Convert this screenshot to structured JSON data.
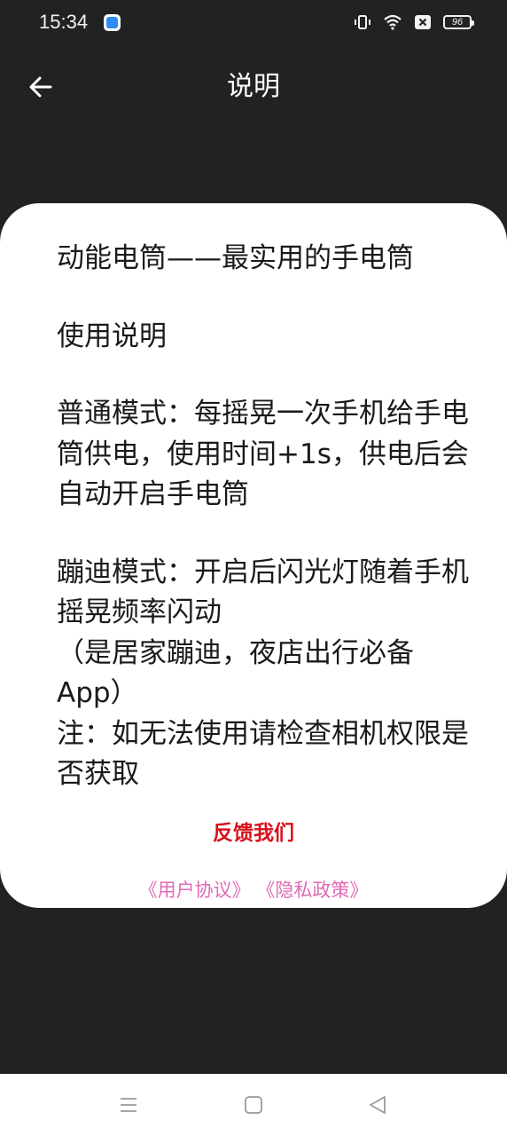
{
  "status_bar": {
    "time": "15:34",
    "battery_level": "96",
    "icons": [
      "app-notification-icon",
      "vibrate-icon",
      "wifi-icon",
      "no-sim-icon",
      "battery-icon"
    ]
  },
  "app_bar": {
    "title": "说明",
    "back_icon": "arrow-left-icon"
  },
  "content": {
    "headline": "动能电筒——最实用的手电筒",
    "section_title": "使用说明",
    "normal_mode": "普通模式：每摇晃一次手机给手电筒供电，使用时间+1s，供电后会自动开启手电筒",
    "disco_mode": "蹦迪模式：开启后闪光灯随着手机摇晃频率闪动",
    "disco_note": "（是居家蹦迪，夜店出行必备App）",
    "permission_note": "注：如无法使用请检查相机权限是否获取"
  },
  "feedback_label": "反馈我们",
  "links": {
    "user_agreement": "《用户协议》",
    "privacy_policy": "《隐私政策》"
  },
  "colors": {
    "background": "#222222",
    "card": "#ffffff",
    "feedback": "#d8101b",
    "links": "#e06ab4"
  },
  "nav_bar": {
    "icons": [
      "menu-icon",
      "home-icon",
      "back-triangle-icon"
    ]
  }
}
